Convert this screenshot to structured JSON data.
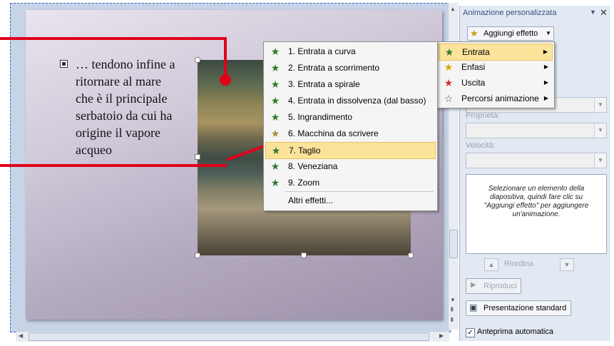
{
  "slide": {
    "body_text": "… tendono infine a ritornare al mare che è il principale serbatoio da cui ha origine il vapore acqueo"
  },
  "entrance_menu": {
    "items": [
      {
        "label": "1. Entrata a curva",
        "icon": "star-curve-icon"
      },
      {
        "label": "2. Entrata a scorrimento",
        "icon": "star-slide-icon"
      },
      {
        "label": "3. Entrata a spirale",
        "icon": "star-spiral-icon"
      },
      {
        "label": "4. Entrata in dissolvenza (dal basso)",
        "icon": "star-fade-icon"
      },
      {
        "label": "5. Ingrandimento",
        "icon": "star-zoom-icon"
      },
      {
        "label": "6. Macchina da scrivere",
        "icon": "star-typewriter-icon"
      },
      {
        "label": "7. Taglio",
        "icon": "star-cut-icon"
      },
      {
        "label": "8. Veneziana",
        "icon": "star-blinds-icon"
      },
      {
        "label": "9. Zoom",
        "icon": "star-zoom2-icon"
      }
    ],
    "more": "Altri effetti..."
  },
  "effect_menu": {
    "items": [
      {
        "label": "Entrata",
        "icon": "entrance-star-icon"
      },
      {
        "label": "Enfasi",
        "icon": "emphasis-star-icon"
      },
      {
        "label": "Uscita",
        "icon": "exit-star-icon"
      },
      {
        "label": "Percorsi animazione",
        "icon": "motion-path-star-icon"
      }
    ]
  },
  "taskpane": {
    "title": "Animazione personalizzata",
    "add_effect": "Aggiungi effetto",
    "property_label": "Proprietà:",
    "speed_label": "Velocità:",
    "hint": "Selezionare un elemento della diapositiva, quindi fare clic su \"Aggiungi effetto\" per aggiungere un'animazione.",
    "reorder": "Riordina",
    "play": "Riproduci",
    "slideshow": "Presentazione standard",
    "autopreview": "Anteprima automatica"
  },
  "colors": {
    "highlight": "#fbe39a",
    "accent_red": "#e1001a",
    "pane_bg": "#e2e9f3"
  }
}
